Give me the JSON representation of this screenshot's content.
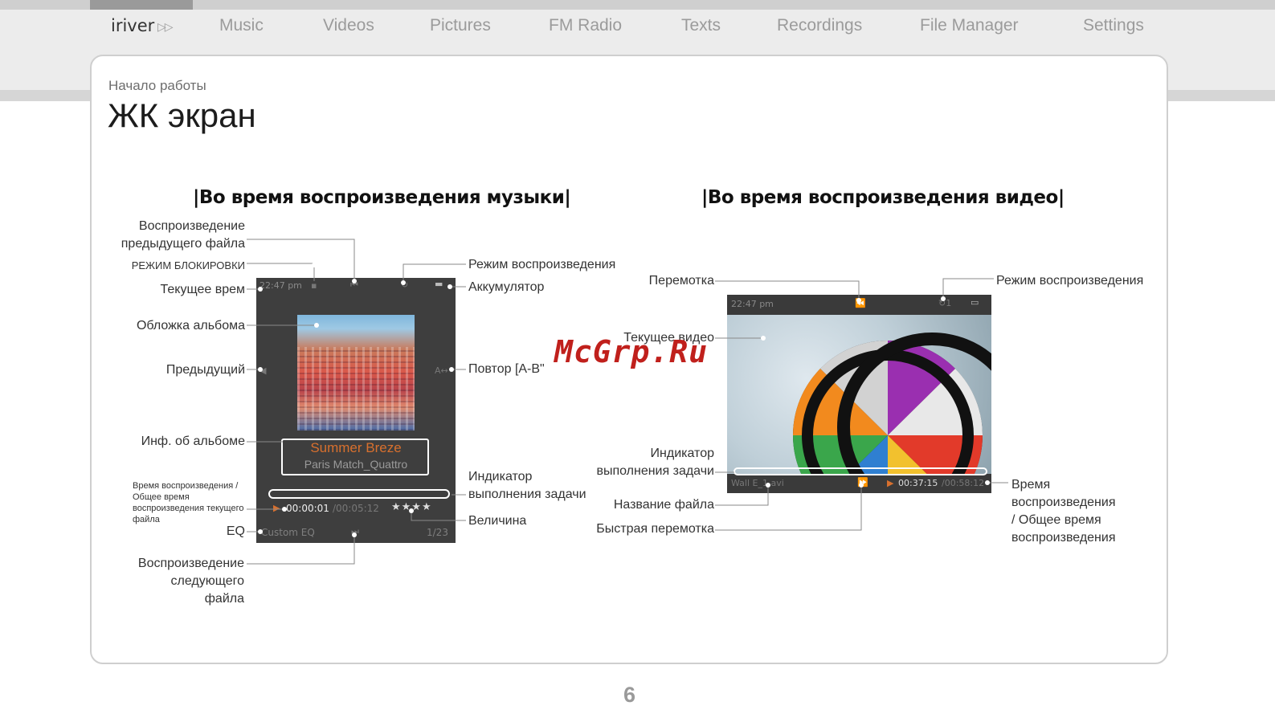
{
  "nav": {
    "brand": "iriver",
    "brand_icon": "double-chevron-right-icon",
    "items": [
      "Music",
      "Videos",
      "Pictures",
      "FM Radio",
      "Texts",
      "Recordings",
      "File Manager",
      "Settings"
    ]
  },
  "page": {
    "breadcrumb": "Начало работы",
    "title": "ЖК экран",
    "page_number": "6",
    "watermark": "McGrp.Ru"
  },
  "music_section": {
    "title": "|Во время воспроизведения музыки|",
    "labels": {
      "prev_file": "Воспроизведение\nпредыдущего файла",
      "lock_mode": "РЕЖИМ БЛОКИРОВКИ",
      "current_time": "Текущее врем",
      "album_art": "Обложка альбома",
      "previous": "Предыдущий",
      "album_info": "Инф. об альбоме",
      "play_time": "Время воспроизведения /\nОбщее время\nвоспроизведения текущего\nфайла",
      "eq": "EQ",
      "next_file": "Воспроизведение\nследующего\nфайла",
      "play_mode": "Режим воспроизведения",
      "battery": "Аккумулятор",
      "repeat_ab": "Повтор [A-B\"",
      "progress": "Индикатор\nвыполнения задачи",
      "rating": "Величина"
    },
    "screen": {
      "status_time": "22:47 pm",
      "song_title": "Summer Breze",
      "song_artist": "Paris Match_Quattro",
      "time": "00:00:01",
      "total": "/00:05:12",
      "rating": "★★★★",
      "eq": "Custom EQ",
      "track": "1/23"
    }
  },
  "video_section": {
    "title": "|Во время воспроизведения видео|",
    "labels": {
      "rewind": "Перемотка",
      "play_mode": "Режим воспроизведения",
      "current_video": "Текущее видео",
      "progress": "Индикатор\nвыполнения задачи",
      "file_name": "Название файла",
      "fast_forward": "Быстрая перемотка",
      "play_time": "Время\nвоспроизведения\n/ Общее время\nвоспроизведения"
    },
    "screen": {
      "status_time": "22:47 pm",
      "file": "Wall E_1.avi",
      "time": "00:37:15",
      "total": "/00:58:12"
    }
  },
  "colors": {
    "screen_bg": "#3e3e3e",
    "song_title": "#d8702e",
    "watermark": "#c0201c",
    "nav_text": "#9b9b9b"
  }
}
